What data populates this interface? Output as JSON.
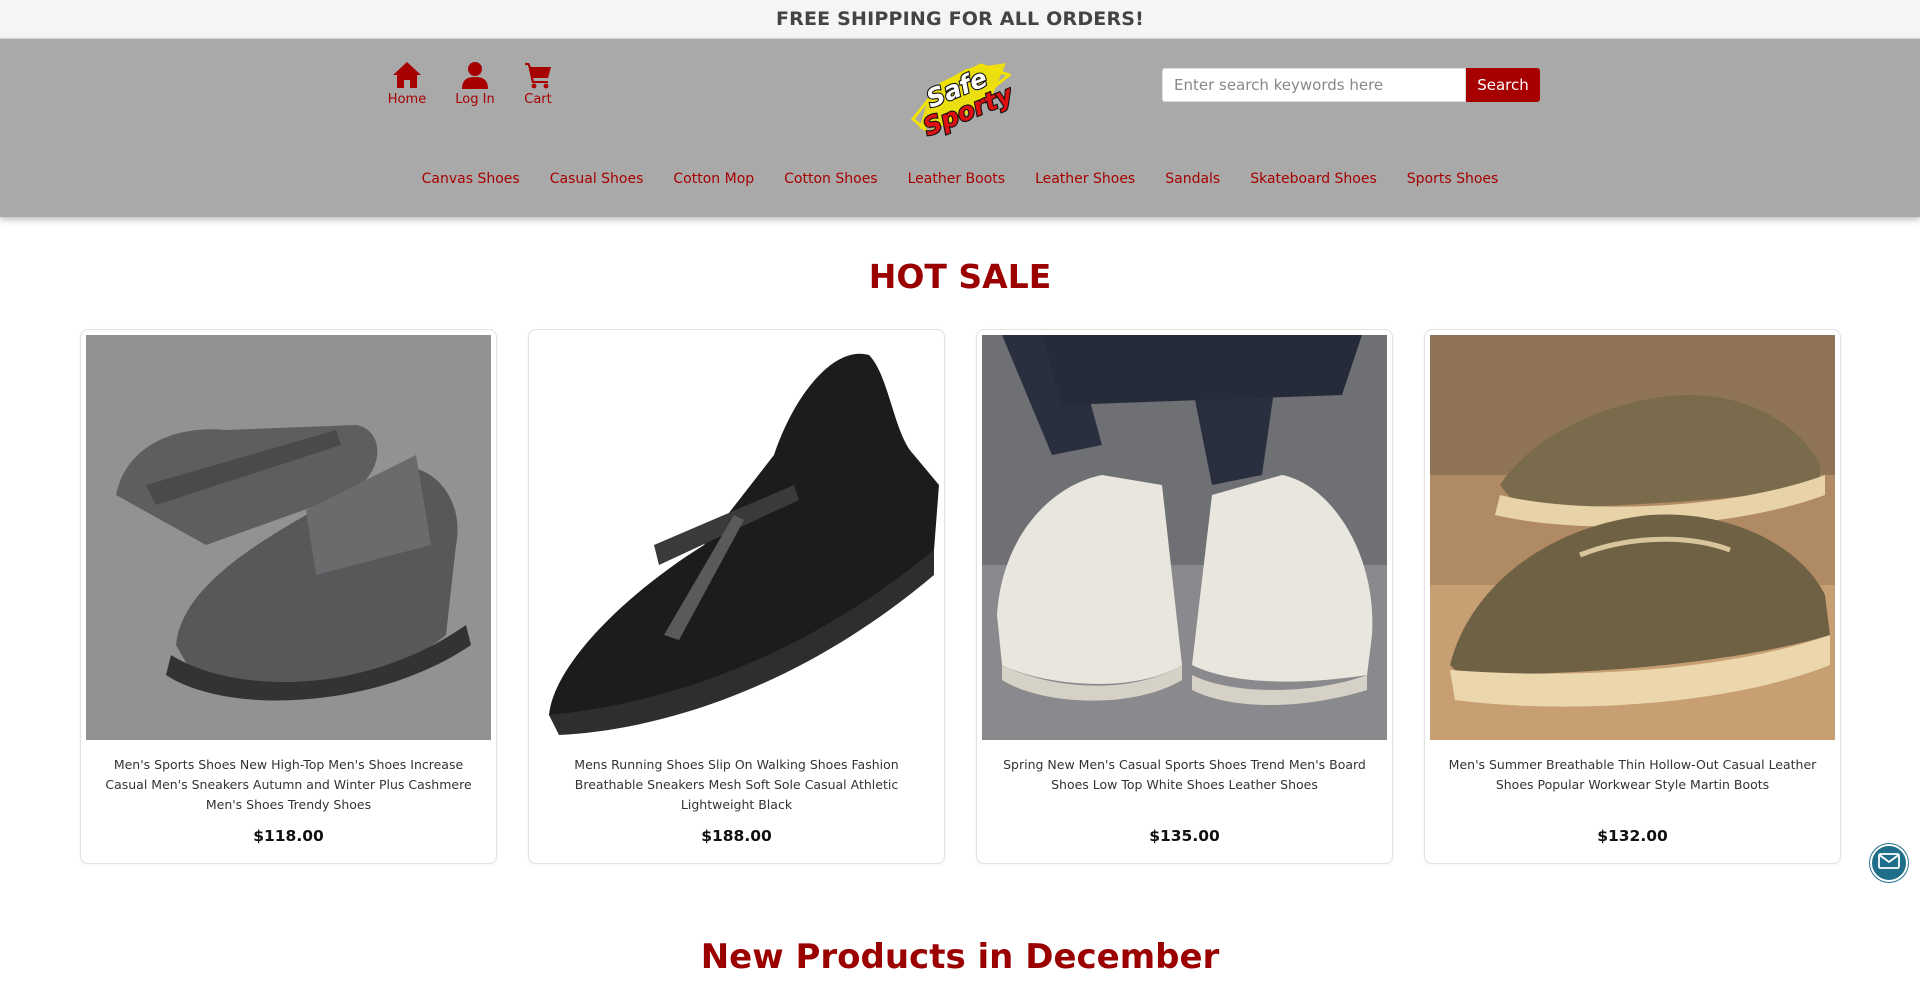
{
  "banner": {
    "text": "FREE SHIPPING FOR ALL ORDERS!"
  },
  "header": {
    "nav": [
      {
        "label": "Home",
        "icon": "home-icon"
      },
      {
        "label": "Log In",
        "icon": "user-icon"
      },
      {
        "label": "Cart",
        "icon": "cart-icon"
      }
    ],
    "logo": {
      "line1": "Safe",
      "line2": "Sporty"
    },
    "search": {
      "placeholder": "Enter search keywords here",
      "value": "",
      "button_label": "Search"
    },
    "categories": [
      "Canvas Shoes",
      "Casual Shoes",
      "Cotton Mop",
      "Cotton Shoes",
      "Leather Boots",
      "Leather Shoes",
      "Sandals",
      "Skateboard Shoes",
      "Sports Shoes"
    ]
  },
  "hot_sale": {
    "title": "HOT SALE",
    "products": [
      {
        "name": "Men's Sports Shoes New High-Top Men's Shoes Increase Casual Men's Sneakers Autumn and Winter Plus Cashmere Men's Shoes Trendy Shoes",
        "price": "$118.00"
      },
      {
        "name": "Mens Running Shoes Slip On Walking Shoes Fashion Breathable Sneakers Mesh Soft Sole Casual Athletic Lightweight Black",
        "price": "$188.00"
      },
      {
        "name": "Spring New Men's Casual Sports Shoes Trend Men's Board Shoes Low Top White Shoes Leather Shoes",
        "price": "$135.00"
      },
      {
        "name": "Men's Summer Breathable Thin Hollow-Out Casual Leather Shoes Popular Workwear Style Martin Boots",
        "price": "$132.00"
      }
    ]
  },
  "new_products": {
    "title": "New Products in December"
  },
  "colors": {
    "brand_red": "#a70000",
    "header_gray": "#a9a9a9",
    "mail_button": "#1f6f8b"
  }
}
